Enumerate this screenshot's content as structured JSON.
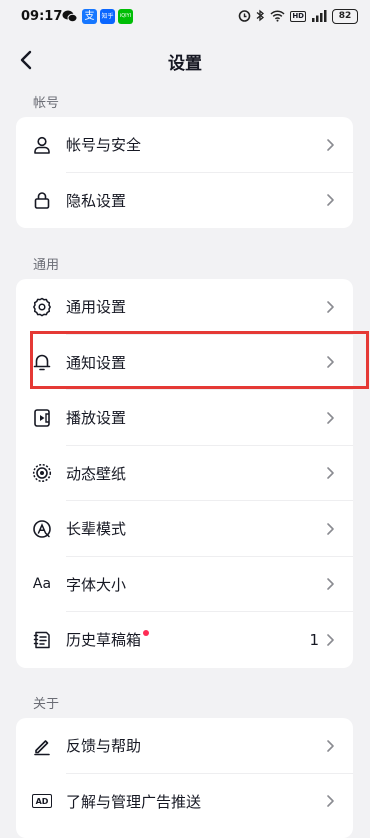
{
  "status_bar": {
    "time": "09:17",
    "battery": "82",
    "hd_label": "HD",
    "notif_apps": [
      {
        "icon": "wechat-icon",
        "color": "#111111"
      },
      {
        "icon": "alipay-icon",
        "color": "#1677ff",
        "text": "支"
      },
      {
        "icon": "zhihu-icon",
        "color": "#0a66ff",
        "text": "知乎"
      },
      {
        "icon": "iqiyi-icon",
        "color": "#00be06",
        "text": "iQIYI"
      }
    ]
  },
  "header": {
    "title": "设置"
  },
  "sections": [
    {
      "label": "帐号",
      "items": [
        {
          "label": "帐号与安全",
          "icon": "user-icon"
        },
        {
          "label": "隐私设置",
          "icon": "lock-icon"
        }
      ]
    },
    {
      "label": "通用",
      "items": [
        {
          "label": "通用设置",
          "icon": "gear-icon"
        },
        {
          "label": "通知设置",
          "icon": "bell-icon"
        },
        {
          "label": "播放设置",
          "icon": "playback-icon"
        },
        {
          "label": "动态壁纸",
          "icon": "live-wallpaper-icon"
        },
        {
          "label": "长辈模式",
          "icon": "elder-mode-icon"
        },
        {
          "label": "字体大小",
          "icon": "font-size-icon",
          "icon_text": "Aa"
        },
        {
          "label": "历史草稿箱",
          "icon": "drafts-icon",
          "count": "1",
          "badge_color": "#fe2c55"
        }
      ]
    },
    {
      "label": "关于",
      "items": [
        {
          "label": "反馈与帮助",
          "icon": "edit-icon"
        },
        {
          "label": "了解与管理广告推送",
          "icon": "ad-icon",
          "icon_text": "AD"
        }
      ]
    }
  ],
  "accent_colors": {
    "highlight_box": "#e53935",
    "badge": "#fe2c55"
  }
}
